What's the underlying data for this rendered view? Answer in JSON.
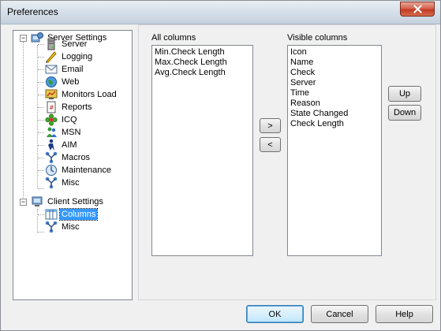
{
  "window": {
    "title": "Preferences"
  },
  "tree": {
    "items": [
      {
        "label": "Server Settings",
        "icon": "server-settings-icon"
      },
      {
        "label": "Server",
        "icon": "server-icon"
      },
      {
        "label": "Logging",
        "icon": "logging-icon"
      },
      {
        "label": "Email",
        "icon": "email-icon"
      },
      {
        "label": "Web",
        "icon": "web-icon"
      },
      {
        "label": "Monitors Load",
        "icon": "monitors-load-icon"
      },
      {
        "label": "Reports",
        "icon": "reports-icon"
      },
      {
        "label": "ICQ",
        "icon": "icq-icon"
      },
      {
        "label": "MSN",
        "icon": "msn-icon"
      },
      {
        "label": "AIM",
        "icon": "aim-icon"
      },
      {
        "label": "Macros",
        "icon": "macros-icon"
      },
      {
        "label": "Maintenance",
        "icon": "maintenance-icon"
      },
      {
        "label": "Misc",
        "icon": "misc-icon"
      },
      {
        "label": "Client Settings",
        "icon": "client-settings-icon"
      },
      {
        "label": "Columns",
        "icon": "columns-icon",
        "selected": true
      },
      {
        "label": "Misc",
        "icon": "misc-icon"
      }
    ]
  },
  "columns": {
    "all_label": "All columns",
    "all_items": [
      "Min.Check Length",
      "Max.Check Length",
      "Avg.Check Length"
    ],
    "visible_label": "Visible columns",
    "visible_items": [
      "Icon",
      "Name",
      "Check",
      "Server",
      "Time",
      "Reason",
      "State Changed",
      "Check Length"
    ],
    "add_label": ">",
    "remove_label": "<",
    "up_label": "Up",
    "down_label": "Down"
  },
  "footer": {
    "ok_label": "OK",
    "cancel_label": "Cancel",
    "help_label": "Help"
  },
  "colors": {
    "selection": "#3399ff",
    "close_button": "#c23a22"
  }
}
